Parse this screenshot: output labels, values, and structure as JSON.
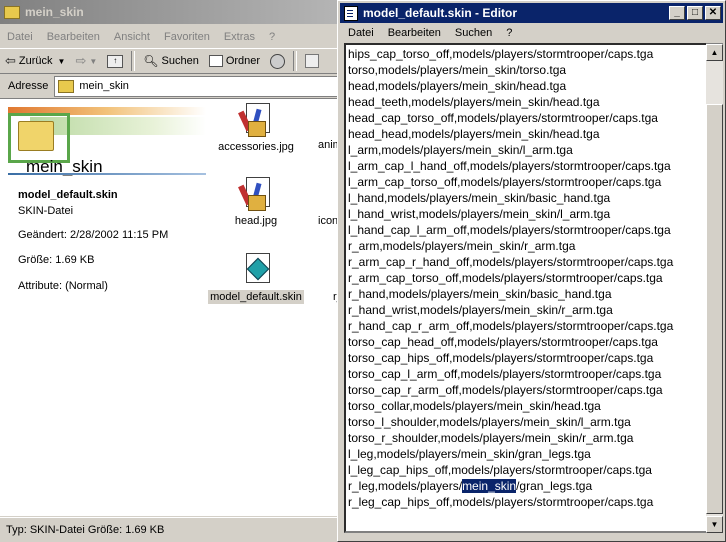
{
  "explorer": {
    "title": "mein_skin",
    "menu": [
      "Datei",
      "Bearbeiten",
      "Ansicht",
      "Favoriten",
      "Extras",
      "?"
    ],
    "toolbar": {
      "back": "Zurück",
      "search": "Suchen",
      "folders": "Ordner"
    },
    "address_label": "Adresse",
    "address_value": "mein_skin",
    "folder_title": "mein_skin",
    "details": {
      "name": "model_default.skin",
      "type": "SKIN-Datei",
      "modified": "Geändert: 2/28/2002 11:15 PM",
      "size": "Größe: 1.69 KB",
      "attributes": "Attribute: (Normal)"
    },
    "files": [
      {
        "name": "accessories.jpg",
        "icon": "image-file-icon"
      },
      {
        "name": "head.jpg",
        "icon": "image-file-icon"
      },
      {
        "name": "model_default.skin",
        "icon": "skin-file-icon"
      }
    ],
    "cut_labels": [
      "anim",
      "icon",
      "r_"
    ],
    "status": "Typ: SKIN-Datei Größe: 1.69 KB"
  },
  "editor": {
    "title": "model_default.skin - Editor",
    "menu": [
      "Datei",
      "Bearbeiten",
      "Suchen",
      "?"
    ],
    "lines": [
      "hips_cap_torso_off,models/players/stormtrooper/caps.tga",
      "torso,models/players/mein_skin/torso.tga",
      "head,models/players/mein_skin/head.tga",
      "head_teeth,models/players/mein_skin/head.tga",
      "head_cap_torso_off,models/players/stormtrooper/caps.tga",
      "head_head,models/players/mein_skin/head.tga",
      "l_arm,models/players/mein_skin/l_arm.tga",
      "l_arm_cap_l_hand_off,models/players/stormtrooper/caps.tga",
      "l_arm_cap_torso_off,models/players/stormtrooper/caps.tga",
      "l_hand,models/players/mein_skin/basic_hand.tga",
      "l_hand_wrist,models/players/mein_skin/l_arm.tga",
      "l_hand_cap_l_arm_off,models/players/stormtrooper/caps.tga",
      "r_arm,models/players/mein_skin/r_arm.tga",
      "r_arm_cap_r_hand_off,models/players/stormtrooper/caps.tga",
      "r_arm_cap_torso_off,models/players/stormtrooper/caps.tga",
      "r_hand,models/players/mein_skin/basic_hand.tga",
      "r_hand_wrist,models/players/mein_skin/r_arm.tga",
      "r_hand_cap_r_arm_off,models/players/stormtrooper/caps.tga",
      "torso_cap_head_off,models/players/stormtrooper/caps.tga",
      "torso_cap_hips_off,models/players/stormtrooper/caps.tga",
      "torso_cap_l_arm_off,models/players/stormtrooper/caps.tga",
      "torso_cap_r_arm_off,models/players/stormtrooper/caps.tga",
      "torso_collar,models/players/mein_skin/head.tga",
      "torso_l_shoulder,models/players/mein_skin/l_arm.tga",
      "torso_r_shoulder,models/players/mein_skin/r_arm.tga",
      "l_leg,models/players/mein_skin/gran_legs.tga",
      "l_leg_cap_hips_off,models/players/stormtrooper/caps.tga"
    ],
    "selected_line": {
      "before": "r_leg,models/players/",
      "selected": "mein_skin",
      "after": "/gran_legs.tga"
    },
    "last_line": "r_leg_cap_hips_off,models/players/stormtrooper/caps.tga"
  }
}
